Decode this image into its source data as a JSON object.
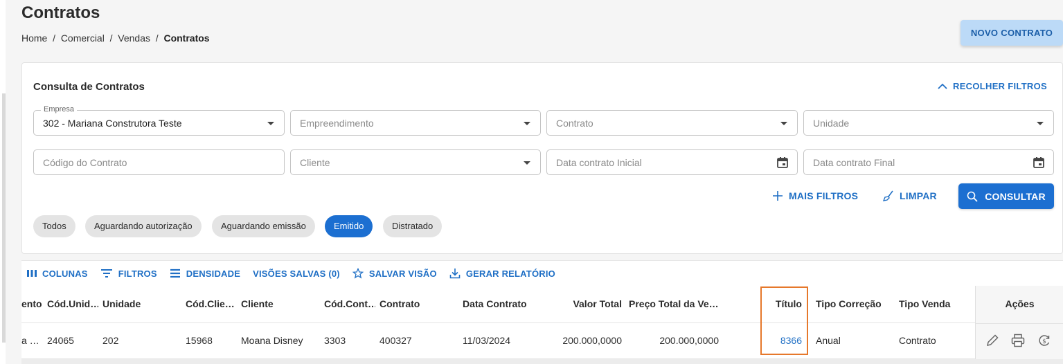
{
  "page": {
    "title": "Contratos",
    "breadcrumb": [
      "Home",
      "Comercial",
      "Vendas",
      "Contratos"
    ],
    "new_button": "NOVO CONTRATO"
  },
  "filters": {
    "title": "Consulta de Contratos",
    "collapse_label": "RECOLHER FILTROS",
    "empresa": {
      "label": "Empresa",
      "value": "302 - Mariana Construtora Teste"
    },
    "empreendimento": {
      "placeholder": "Empreendimento"
    },
    "contrato": {
      "placeholder": "Contrato"
    },
    "unidade": {
      "placeholder": "Unidade"
    },
    "codigo_contrato": {
      "placeholder": "Código do Contrato"
    },
    "cliente": {
      "placeholder": "Cliente"
    },
    "data_inicial": {
      "placeholder": "Data contrato Inicial"
    },
    "data_final": {
      "placeholder": "Data contrato Final"
    },
    "more_filters": "MAIS FILTROS",
    "clear": "LIMPAR",
    "search": "CONSULTAR",
    "status_chips": [
      {
        "label": "Todos",
        "active": false
      },
      {
        "label": "Aguardando autorização",
        "active": false
      },
      {
        "label": "Aguardando emissão",
        "active": false
      },
      {
        "label": "Emitido",
        "active": true
      },
      {
        "label": "Distratado",
        "active": false
      }
    ]
  },
  "toolbar": {
    "columns": "COLUNAS",
    "filters": "FILTROS",
    "density": "DENSIDADE",
    "saved_views": "VISÕES SALVAS (0)",
    "save_view": "SALVAR VISÃO",
    "report": "GERAR RELATÓRIO"
  },
  "table": {
    "headers": {
      "empreendimento": "ento",
      "cod_unidade": "Cód.Unid…",
      "unidade": "Unidade",
      "cod_cliente": "Cód.Clie…",
      "cliente": "Cliente",
      "cod_contrato": "Cód.Cont…",
      "contrato": "Contrato",
      "data_contrato": "Data Contrato",
      "valor_total": "Valor Total",
      "preco_total": "Preço Total da Ve…",
      "titulo": "Título",
      "tipo_correcao": "Tipo Correção",
      "tipo_venda": "Tipo Venda",
      "acoes": "Ações"
    },
    "rows": [
      {
        "empreendimento": "a …",
        "cod_unidade": "24065",
        "unidade": "202",
        "cod_cliente": "15968",
        "cliente": "Moana Disney",
        "cod_contrato": "3303",
        "contrato": "400327",
        "data_contrato": "11/03/2024",
        "valor_total": "200.000,0000",
        "preco_total": "200.000,0000",
        "titulo": "8366",
        "tipo_correcao": "Anual",
        "tipo_venda": "Contrato"
      }
    ]
  },
  "colors": {
    "accent": "#1c6fd1",
    "link": "#1f6fc5",
    "highlight": "#e6782b"
  }
}
